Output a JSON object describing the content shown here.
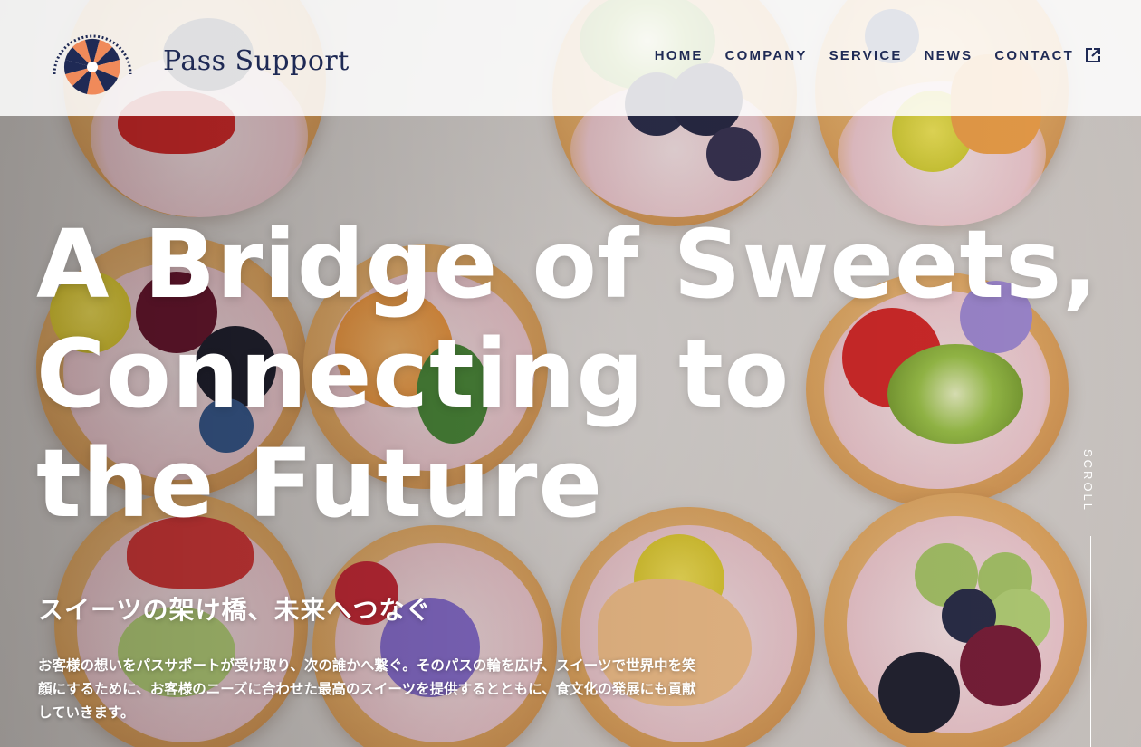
{
  "header": {
    "brand_name": "Pass Support",
    "logo_icon": "sunburst-fan-logo",
    "nav": [
      {
        "label": "HOME"
      },
      {
        "label": "COMPANY"
      },
      {
        "label": "SERVICE"
      },
      {
        "label": "NEWS"
      },
      {
        "label": "CONTACT",
        "icon": "external-link-icon"
      }
    ]
  },
  "hero": {
    "headline_lines": [
      "A Bridge of Sweets,",
      "Connecting to",
      "the Future"
    ],
    "subheadline": "スイーツの架け橋、未来へつなぐ",
    "description": "お客様の想いをパスサポートが受け取り、次の誰かへ繋ぐ。そのパスの輪を広げ、スイーツで世界中を笑顔にするために、お客様のニーズに合わせた最高のスイーツを提供するとともに、食文化の発展にも貢献していきます。",
    "scroll_label": "SCROLL",
    "background": "pastry tarts with cream and fresh fruits"
  },
  "colors": {
    "brand_navy": "#1f2a55",
    "logo_orange": "#f08a5a",
    "hero_text": "#ffffff"
  }
}
